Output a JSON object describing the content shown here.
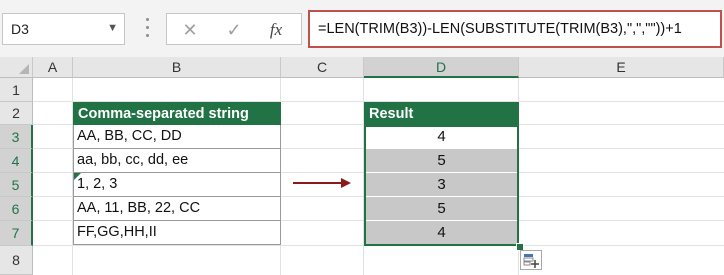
{
  "formula_bar": {
    "name_box": "D3",
    "formula": "=LEN(TRIM(B3))-LEN(SUBSTITUTE(TRIM(B3),\",\",\"\"))+1",
    "cancel_icon": "close-icon",
    "enter_icon": "checkmark-icon",
    "fx_label": "fx"
  },
  "columns": [
    "A",
    "B",
    "C",
    "D",
    "E"
  ],
  "selected_column": "D",
  "rows": [
    "1",
    "2",
    "3",
    "4",
    "5",
    "6",
    "7",
    "8"
  ],
  "source_table": {
    "header": "Comma-separated string",
    "cells": [
      "AA, BB, CC, DD",
      "aa, bb, cc, dd, ee",
      "1, 2, 3",
      "AA, 11, BB, 22, CC",
      "FF,GG,HH,II"
    ]
  },
  "result_table": {
    "header": "Result",
    "cells": [
      "4",
      "5",
      "3",
      "5",
      "4"
    ]
  },
  "colors": {
    "accent": "#217346",
    "arrow": "#8b1a1a",
    "formula_border": "#c0504d"
  }
}
